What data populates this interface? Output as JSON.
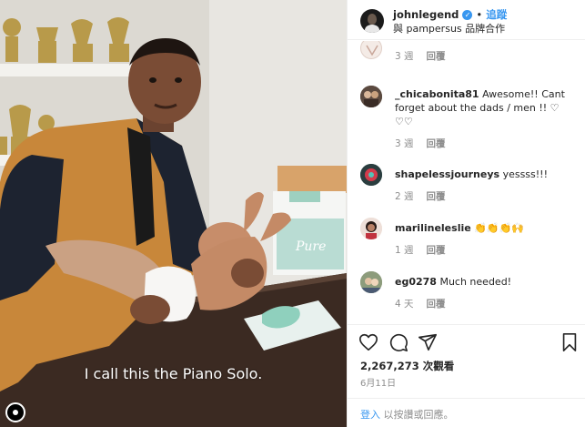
{
  "video": {
    "caption": "I call this the Piano Solo."
  },
  "header": {
    "username": "johnlegend",
    "verified_mark": "✓",
    "separator": "•",
    "follow_label": "追蹤",
    "partner_text": "與 pampersus 品牌合作"
  },
  "comments": [
    {
      "username": "",
      "text": "",
      "age": "3 週",
      "reply_label": "回覆"
    },
    {
      "username": "_chicabonita81",
      "text": "Awesome!! Cant forget about the dads / men !! ♡ ♡♡",
      "age": "3 週",
      "reply_label": "回覆"
    },
    {
      "username": "shapelessjourneys",
      "text": "yessss!!!",
      "age": "2 週",
      "reply_label": "回覆"
    },
    {
      "username": "marilineleslie",
      "text": "👏👏👏🙌",
      "age": "1 週",
      "reply_label": "回覆"
    },
    {
      "username": "eg0278",
      "text": "Much needed!",
      "age": "4 天",
      "reply_label": "回覆"
    }
  ],
  "actions": {
    "views": "2,267,273 次觀看",
    "date": "6月11日",
    "login_link": "登入",
    "login_suffix": " 以按讚或回應。"
  },
  "icons": [
    "heart-icon",
    "comment-icon",
    "share-icon",
    "bookmark-icon"
  ],
  "colors": {
    "link": "#3897f0",
    "muted": "#8e8e8e",
    "text": "#262626"
  }
}
